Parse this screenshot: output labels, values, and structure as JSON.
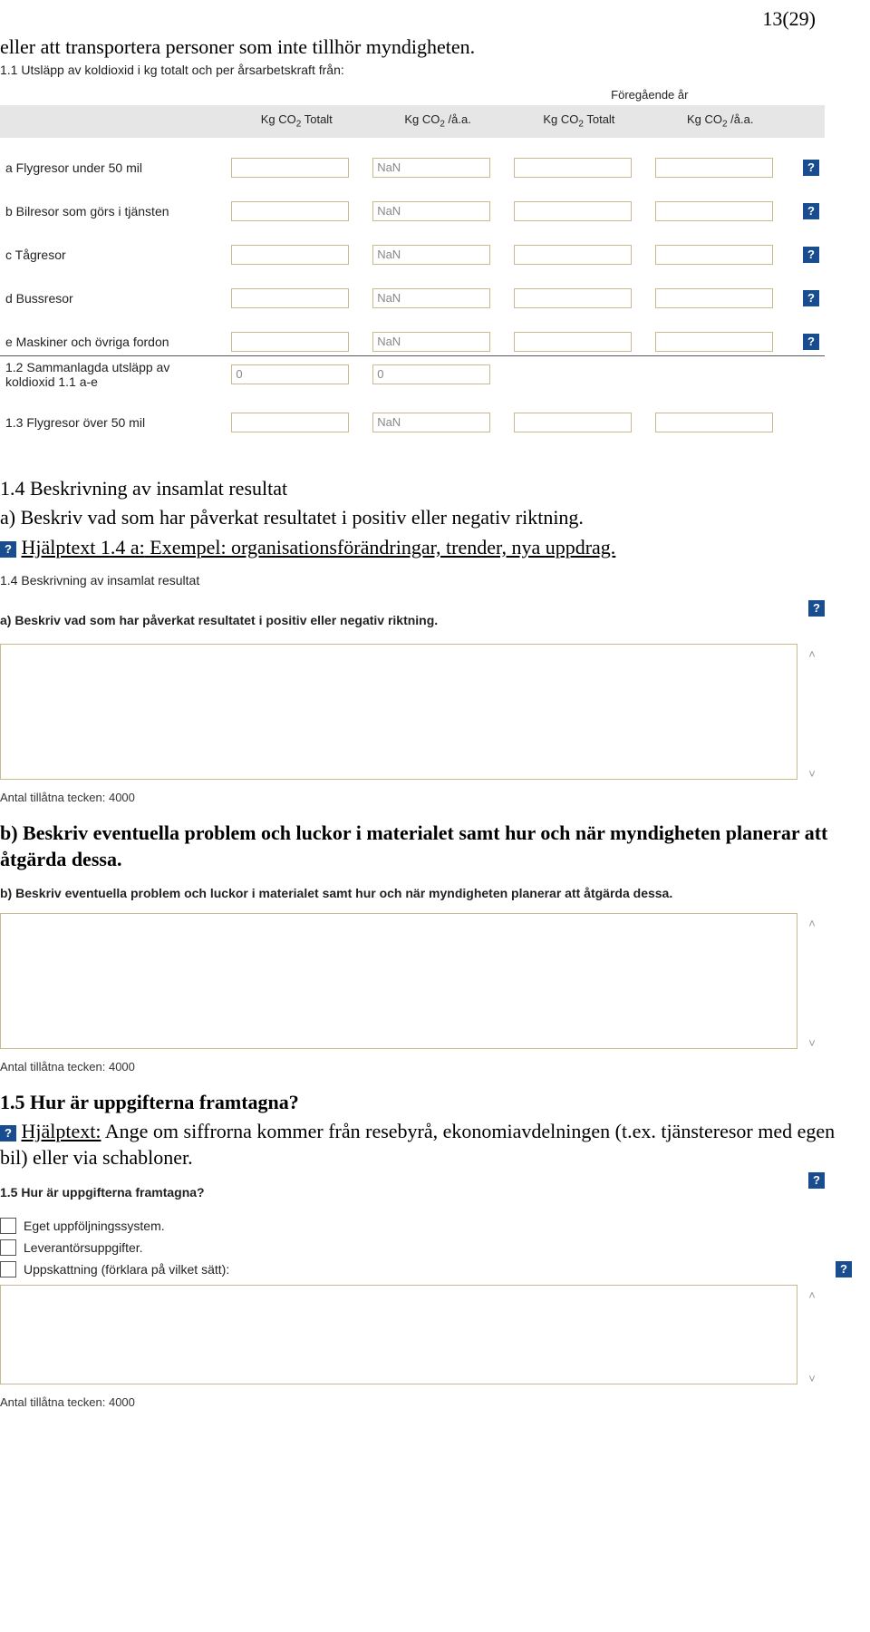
{
  "page_number": "13(29)",
  "intro_line": "eller att transportera personer som inte tillhör myndigheten.",
  "sec11_title": "1.1 Utsläpp av koldioxid i kg totalt och per årsarbetskraft från:",
  "table": {
    "prev_year": "Föregående år",
    "col1": "Kg CO",
    "col1b": " Totalt",
    "col2": "Kg CO",
    "col2b": " /å.a.",
    "rows": [
      {
        "label": "a Flygresor under 50 mil",
        "v2": "NaN"
      },
      {
        "label": "b Bilresor som görs i tjänsten",
        "v2": "NaN"
      },
      {
        "label": "c Tågresor",
        "v2": "NaN"
      },
      {
        "label": "d Bussresor",
        "v2": "NaN"
      },
      {
        "label": "e Maskiner och övriga fordon",
        "v2": "NaN"
      }
    ],
    "sum_label": "1.2 Sammanlagda utsläpp av koldioxid 1.1 a-e",
    "sum_v1": "0",
    "sum_v2": "0",
    "r13_label": "1.3 Flygresor över 50 mil",
    "r13_v2": "NaN"
  },
  "sec14_title": "1.4 Beskrivning av insamlat resultat",
  "sec14a": "a) Beskriv vad som har påverkat resultatet i positiv eller negativ riktning.",
  "help14a_prefix": "Hjälptext 1.4 a:",
  "help14a_rest": " Exempel: organisationsförändringar, trender, nya uppdrag.",
  "sec14_form_title": "1.4 Beskrivning av insamlat resultat",
  "sec14a_form": "a) Beskriv vad som har påverkat resultatet i positiv eller negativ riktning.",
  "count_note": "Antal tillåtna tecken: 4000",
  "sec14b": "b) Beskriv eventuella problem och luckor i materialet samt hur och när myndigheten planerar att åtgärda dessa.",
  "sec14b_form": "b) Beskriv eventuella problem och luckor i materialet samt hur och när myndigheten planerar att åtgärda dessa.",
  "sec15_title": "1.5 Hur är uppgifterna framtagna?",
  "help15_prefix": "Hjälptext:",
  "help15_rest": " Ange om siffrorna kommer från resebyrå, ekonomiavdelningen (t.ex. tjänsteresor med egen bil) eller via schabloner.",
  "sec15_form_title": "1.5 Hur är uppgifterna framtagna?",
  "opt1": "Eget uppföljningssystem.",
  "opt2": "Leverantörsuppgifter.",
  "opt3": "Uppskattning (förklara på vilket sätt):",
  "help_char": "?"
}
